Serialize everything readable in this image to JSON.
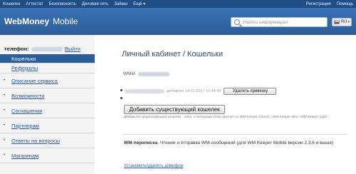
{
  "topnav": {
    "left": [
      "Кошелек",
      "Аттестат",
      "Безопасность",
      "Деловая сеть",
      "Займы",
      "Ещё ▾"
    ],
    "right": [
      "Регистрация",
      "Помощь"
    ]
  },
  "header": {
    "logo_text": "WebMoney",
    "logo_sub": "Mobile",
    "search_placeholder": "Найти информацию",
    "lang_code": "RU",
    "lang_arrow": "▾"
  },
  "sidebar": {
    "phone_label": "телефон:",
    "exit_label": "Выйти",
    "items": [
      {
        "label": "Кошельки",
        "kind": "active"
      },
      {
        "label": "Рефералы",
        "kind": "sub"
      },
      {
        "label": "Описание сервиса",
        "kind": "main"
      },
      {
        "label": "Возможности",
        "kind": "main"
      },
      {
        "label": "Соглашения",
        "kind": "main"
      },
      {
        "label": "Партнерам",
        "kind": "main"
      },
      {
        "label": "Ответы на вопросы",
        "kind": "main"
      },
      {
        "label": "Магазинам",
        "kind": "main"
      }
    ],
    "bullet": "•"
  },
  "content": {
    "title": "Личный кабинет / Кошельки",
    "wmid_label": "WMid",
    "wallet_added": "добавлен 14.01.2017 12:44:43",
    "remove_button": "Удалить привязку",
    "add_button": "Добавить существующий кошелек",
    "note": "Добавьте существующий кошелек - тот, к которому есть доступ из WM Keeper Classic / WM Keeper Mini / WM Keeper Light",
    "wm_title": "WM-переписка",
    "wm_desc": ". Чтение и отправка WM-сообщений (для WM Keeper Mobile версии 2.3.6 и выше)",
    "install_link": "Установить/удалить домофон"
  }
}
